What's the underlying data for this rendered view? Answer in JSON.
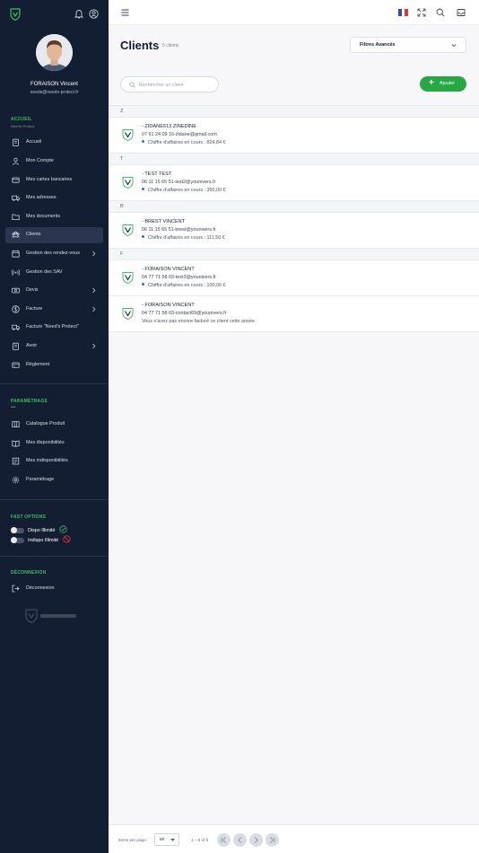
{
  "sidebar": {
    "user_name": "FORAISON Vincent",
    "user_email": "needs@needs-protect.fr",
    "accueil_title": "ACCUEIL",
    "accueil_sub": "Need's Protect",
    "items": [
      {
        "label": "Accueil",
        "icon": "clipboard-icon"
      },
      {
        "label": "Mon Compte",
        "icon": "user-icon"
      },
      {
        "label": "Mes cartes bancaires",
        "icon": "credit-card-icon"
      },
      {
        "label": "Mes adresses",
        "icon": "truck-icon"
      },
      {
        "label": "Mes documents",
        "icon": "folder-icon"
      },
      {
        "label": "Clients",
        "icon": "users-icon",
        "active": true
      },
      {
        "label": "Gestion des rendez-vous",
        "icon": "calendar-icon",
        "chevron": true
      },
      {
        "label": "Gestion des SAV",
        "icon": "broadcast-icon"
      },
      {
        "label": "Devis",
        "icon": "cash-icon",
        "chevron": true
      },
      {
        "label": "Facture",
        "icon": "dollar-icon",
        "chevron": true
      },
      {
        "label": "Facture \"Need's Protect\"",
        "icon": "truck-icon"
      },
      {
        "label": "Avoir",
        "icon": "clipboard-icon",
        "chevron": true
      },
      {
        "label": "Règlement",
        "icon": "wallet-icon"
      }
    ],
    "param_title": "PARAMÉTRAGE",
    "param_dots": "•••",
    "param_items": [
      {
        "label": "Catalogue Produit",
        "icon": "columns-icon"
      },
      {
        "label": "Mes disponibilités",
        "icon": "book-icon"
      },
      {
        "label": "Mes indisponibilités",
        "icon": "book-open-icon"
      },
      {
        "label": "Paramétrage",
        "icon": "gear-icon"
      }
    ],
    "fast_title": "FAST OPTIONS",
    "fast_options": [
      {
        "label": "Dispo Illimité",
        "on": false,
        "icon": "check-circle-icon"
      },
      {
        "label": "Indispo Illimité",
        "on": false,
        "icon": "forbidden-icon"
      }
    ],
    "logout_title": "DÉCONNEXION",
    "logout_label": "Déconnexion"
  },
  "header": {
    "title": "Clients",
    "count": "5 clients",
    "filter_label": "Filtres Avancés",
    "search_placeholder": "Rechercher un client",
    "add_label": "Ajouter"
  },
  "groups": [
    {
      "letter": "Z",
      "clients": [
        {
          "name": "- ZIDANE513 ZINEDINE",
          "contact": "07 61 24 09 16-zidane@gmail.com",
          "ca": "Chiffre d'affaires en cours : 824,84 €"
        }
      ]
    },
    {
      "letter": "T",
      "clients": [
        {
          "name": "- TEST TEST",
          "contact": "06 11 15 65 51-test2@younivers.fr",
          "ca": "Chiffre d'affaires en cours : 350,00 €"
        }
      ]
    },
    {
      "letter": "B",
      "clients": [
        {
          "name": "- BREST VINCENT",
          "contact": "06 11 15 65 51-brest@younivers.fr",
          "ca": "Chiffre d'affaires en cours : 111,50 €"
        }
      ]
    },
    {
      "letter": "F",
      "clients": [
        {
          "name": "- FORAISON VINCENT",
          "contact": "04 77 71 58 03-test3@younivers.fr",
          "ca": "Chiffre d'affaires en cours : 100,00 €"
        },
        {
          "name": "- FORAISON VINCENT",
          "contact": "04 77 71 58 03-contact69@younivers.fr",
          "note": "Vous n'avez pas encore facturé ce client cette année"
        }
      ]
    }
  ],
  "pagination": {
    "items_per_page_label": "Items per page:",
    "items_per_page": "50",
    "range": "1 – 5 of 5"
  },
  "colors": {
    "sidebar_bg": "#141e33",
    "accent_green": "#27a845",
    "section_green": "#3ebd63"
  }
}
